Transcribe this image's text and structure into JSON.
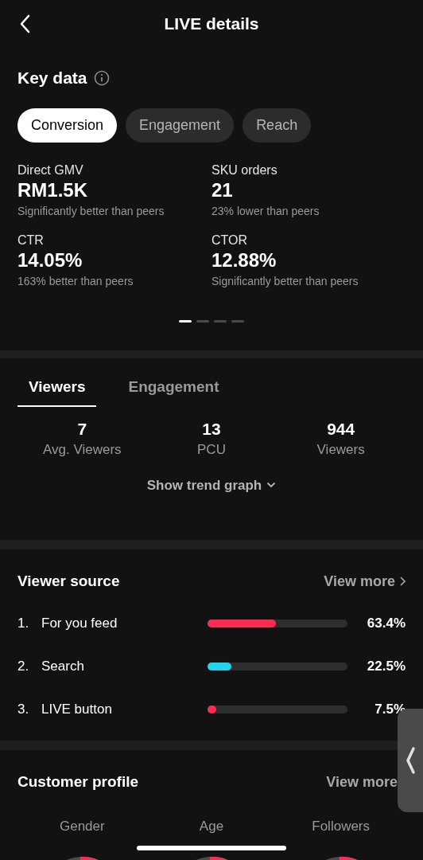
{
  "header": {
    "title": "LIVE details"
  },
  "key_data": {
    "title": "Key data",
    "tabs": [
      {
        "label": "Conversion",
        "selected": true
      },
      {
        "label": "Engagement",
        "selected": false
      },
      {
        "label": "Reach",
        "selected": false
      }
    ],
    "metrics": [
      {
        "label": "Direct GMV",
        "value": "RM1.5K",
        "comparison": "Significantly better than peers"
      },
      {
        "label": "SKU orders",
        "value": "21",
        "comparison": "23% lower than peers"
      },
      {
        "label": "CTR",
        "value": "14.05%",
        "comparison": "163% better than peers"
      },
      {
        "label": "CTOR",
        "value": "12.88%",
        "comparison": "Significantly better than peers"
      }
    ],
    "pages": [
      {
        "selected": true
      },
      {
        "selected": false
      },
      {
        "selected": false
      },
      {
        "selected": false
      }
    ]
  },
  "viewers": {
    "tabs": [
      {
        "label": "Viewers",
        "selected": true
      },
      {
        "label": "Engagement",
        "selected": false
      }
    ],
    "stats": [
      {
        "value": "7",
        "label": "Avg. Viewers"
      },
      {
        "value": "13",
        "label": "PCU"
      },
      {
        "value": "944",
        "label": "Viewers"
      }
    ],
    "trend_link": "Show trend graph"
  },
  "viewer_source": {
    "title": "Viewer source",
    "link": "View more",
    "rows": [
      {
        "rank": "1.",
        "name": "For you feed",
        "level": 0.49,
        "color": "#fe2c55",
        "percent": "63.4%"
      },
      {
        "rank": "2.",
        "name": "Search",
        "level": 0.17,
        "color": "#25d4eb",
        "percent": "22.5%"
      },
      {
        "rank": "3.",
        "name": "LIVE button",
        "level": 0.06,
        "color": "#fe2c55",
        "percent": "7.5%"
      }
    ]
  },
  "customer_profile": {
    "title": "Customer profile",
    "link": "View more",
    "columns": [
      "Gender",
      "Age",
      "Followers"
    ]
  }
}
